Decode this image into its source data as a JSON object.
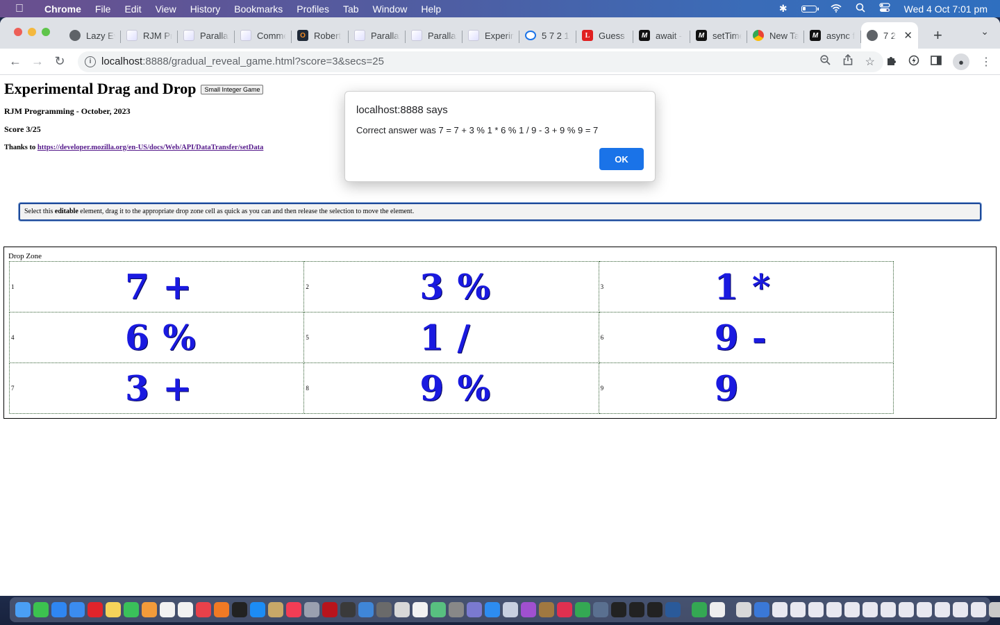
{
  "menubar": {
    "app": "Chrome",
    "items": [
      "File",
      "Edit",
      "View",
      "History",
      "Bookmarks",
      "Profiles",
      "Tab",
      "Window",
      "Help"
    ],
    "clock": "Wed 4 Oct  7:01 pm"
  },
  "tabs": [
    {
      "label": "Lazy Ev",
      "icon": "elephant-icon",
      "style": "fav-gray"
    },
    {
      "label": "RJM Pr",
      "icon": "rjm-icon",
      "style": "fav-rjm"
    },
    {
      "label": "Parallax",
      "icon": "rjm-icon",
      "style": "fav-rjm"
    },
    {
      "label": "Comme",
      "icon": "rjm-icon",
      "style": "fav-rjm"
    },
    {
      "label": "Robert",
      "icon": "o-icon",
      "style": "fav-dark",
      "glyph": "O"
    },
    {
      "label": "Parallax",
      "icon": "rjm-icon",
      "style": "fav-rjm"
    },
    {
      "label": "Parallax",
      "icon": "rjm-icon",
      "style": "fav-rjm"
    },
    {
      "label": "Experin",
      "icon": "rjm-icon",
      "style": "fav-rjm"
    },
    {
      "label": "5 7 2 1",
      "icon": "gauge-icon",
      "style": "fav-blue"
    },
    {
      "label": "Guess t",
      "icon": "l-icon",
      "style": "fav-red",
      "glyph": "L"
    },
    {
      "label": "await -",
      "icon": "mdn-icon",
      "style": "fav-m",
      "glyph": "M"
    },
    {
      "label": "setTime",
      "icon": "mdn-icon",
      "style": "fav-m",
      "glyph": "M"
    },
    {
      "label": "New Ta",
      "icon": "chrome-icon",
      "style": "fav-chrome"
    },
    {
      "label": "async f",
      "icon": "mdn-icon",
      "style": "fav-m",
      "glyph": "M"
    },
    {
      "label": "7 2",
      "icon": "elephant-icon",
      "style": "fav-gray",
      "active": true
    }
  ],
  "address": {
    "host": "localhost",
    "rest": ":8888/gradual_reveal_game.html?score=3&secs=25"
  },
  "page": {
    "title": "Experimental Drag and Drop",
    "game_button": "Small Integer Game",
    "byline": "RJM Programming - October, 2023",
    "score": "Score 3/25",
    "thanks_prefix": "Thanks to ",
    "thanks_link": "https://developer.mozilla.org/en-US/docs/Web/API/DataTransfer/setData",
    "editable_pre": "Select this ",
    "editable_bold": "editable",
    "editable_post": " element, drag it to the appropriate drop zone cell as quick as you can and then release the selection to move the element.",
    "dropzone_label": "Drop Zone",
    "cells": [
      {
        "num": "1",
        "token": "7 +"
      },
      {
        "num": "2",
        "token": "3 %"
      },
      {
        "num": "3",
        "token": "1 *"
      },
      {
        "num": "4",
        "token": "6 %"
      },
      {
        "num": "5",
        "token": "1 /"
      },
      {
        "num": "6",
        "token": "9 -"
      },
      {
        "num": "7",
        "token": "3 +"
      },
      {
        "num": "8",
        "token": "9 %"
      },
      {
        "num": "9",
        "token": "9"
      }
    ]
  },
  "alert": {
    "title": "localhost:8888 says",
    "message": "Correct answer was 7 = 7 + 3 % 1 * 6 % 1 / 9 - 3 + 9 % 9 = 7",
    "ok": "OK"
  },
  "dock": {
    "colors": [
      "#4a9ff5",
      "#3cc24f",
      "#2f86f2",
      "#3b8cf0",
      "#e0242b",
      "#f5d35a",
      "#3ac15a",
      "#f29b3a",
      "#f2f2f2",
      "#f2f2f2",
      "#e8414a",
      "#f07a24",
      "#222222",
      "#1c8cf5",
      "#c8a868",
      "#f23d55",
      "#9aa0b0",
      "#b8141c",
      "#3a3a3a",
      "#3f86d8",
      "#6a6a6a",
      "#d8d8d8",
      "#f2f2f2",
      "#58c080",
      "#888888",
      "#7a7ad0",
      "#2d8cf0",
      "#c8d0e0",
      "#a050d0",
      "#a07840",
      "#e03050",
      "#34a853",
      "#5a7090",
      "#222222",
      "#222222",
      "#222222",
      "#2a5a9a"
    ],
    "right_colors": [
      "#34a853",
      "#eeeeee"
    ],
    "docs_colors": [
      "#d8d8d8",
      "#3a78d8",
      "#e8e8f0",
      "#e8e8f0",
      "#e8e8f0",
      "#e8e8f0",
      "#e8e8f0",
      "#e8e8f0",
      "#e8e8f0",
      "#e8e8f0",
      "#e8e8f0",
      "#e8e8f0",
      "#e8e8f0",
      "#e8e8f0",
      "#c8c8c8"
    ]
  }
}
